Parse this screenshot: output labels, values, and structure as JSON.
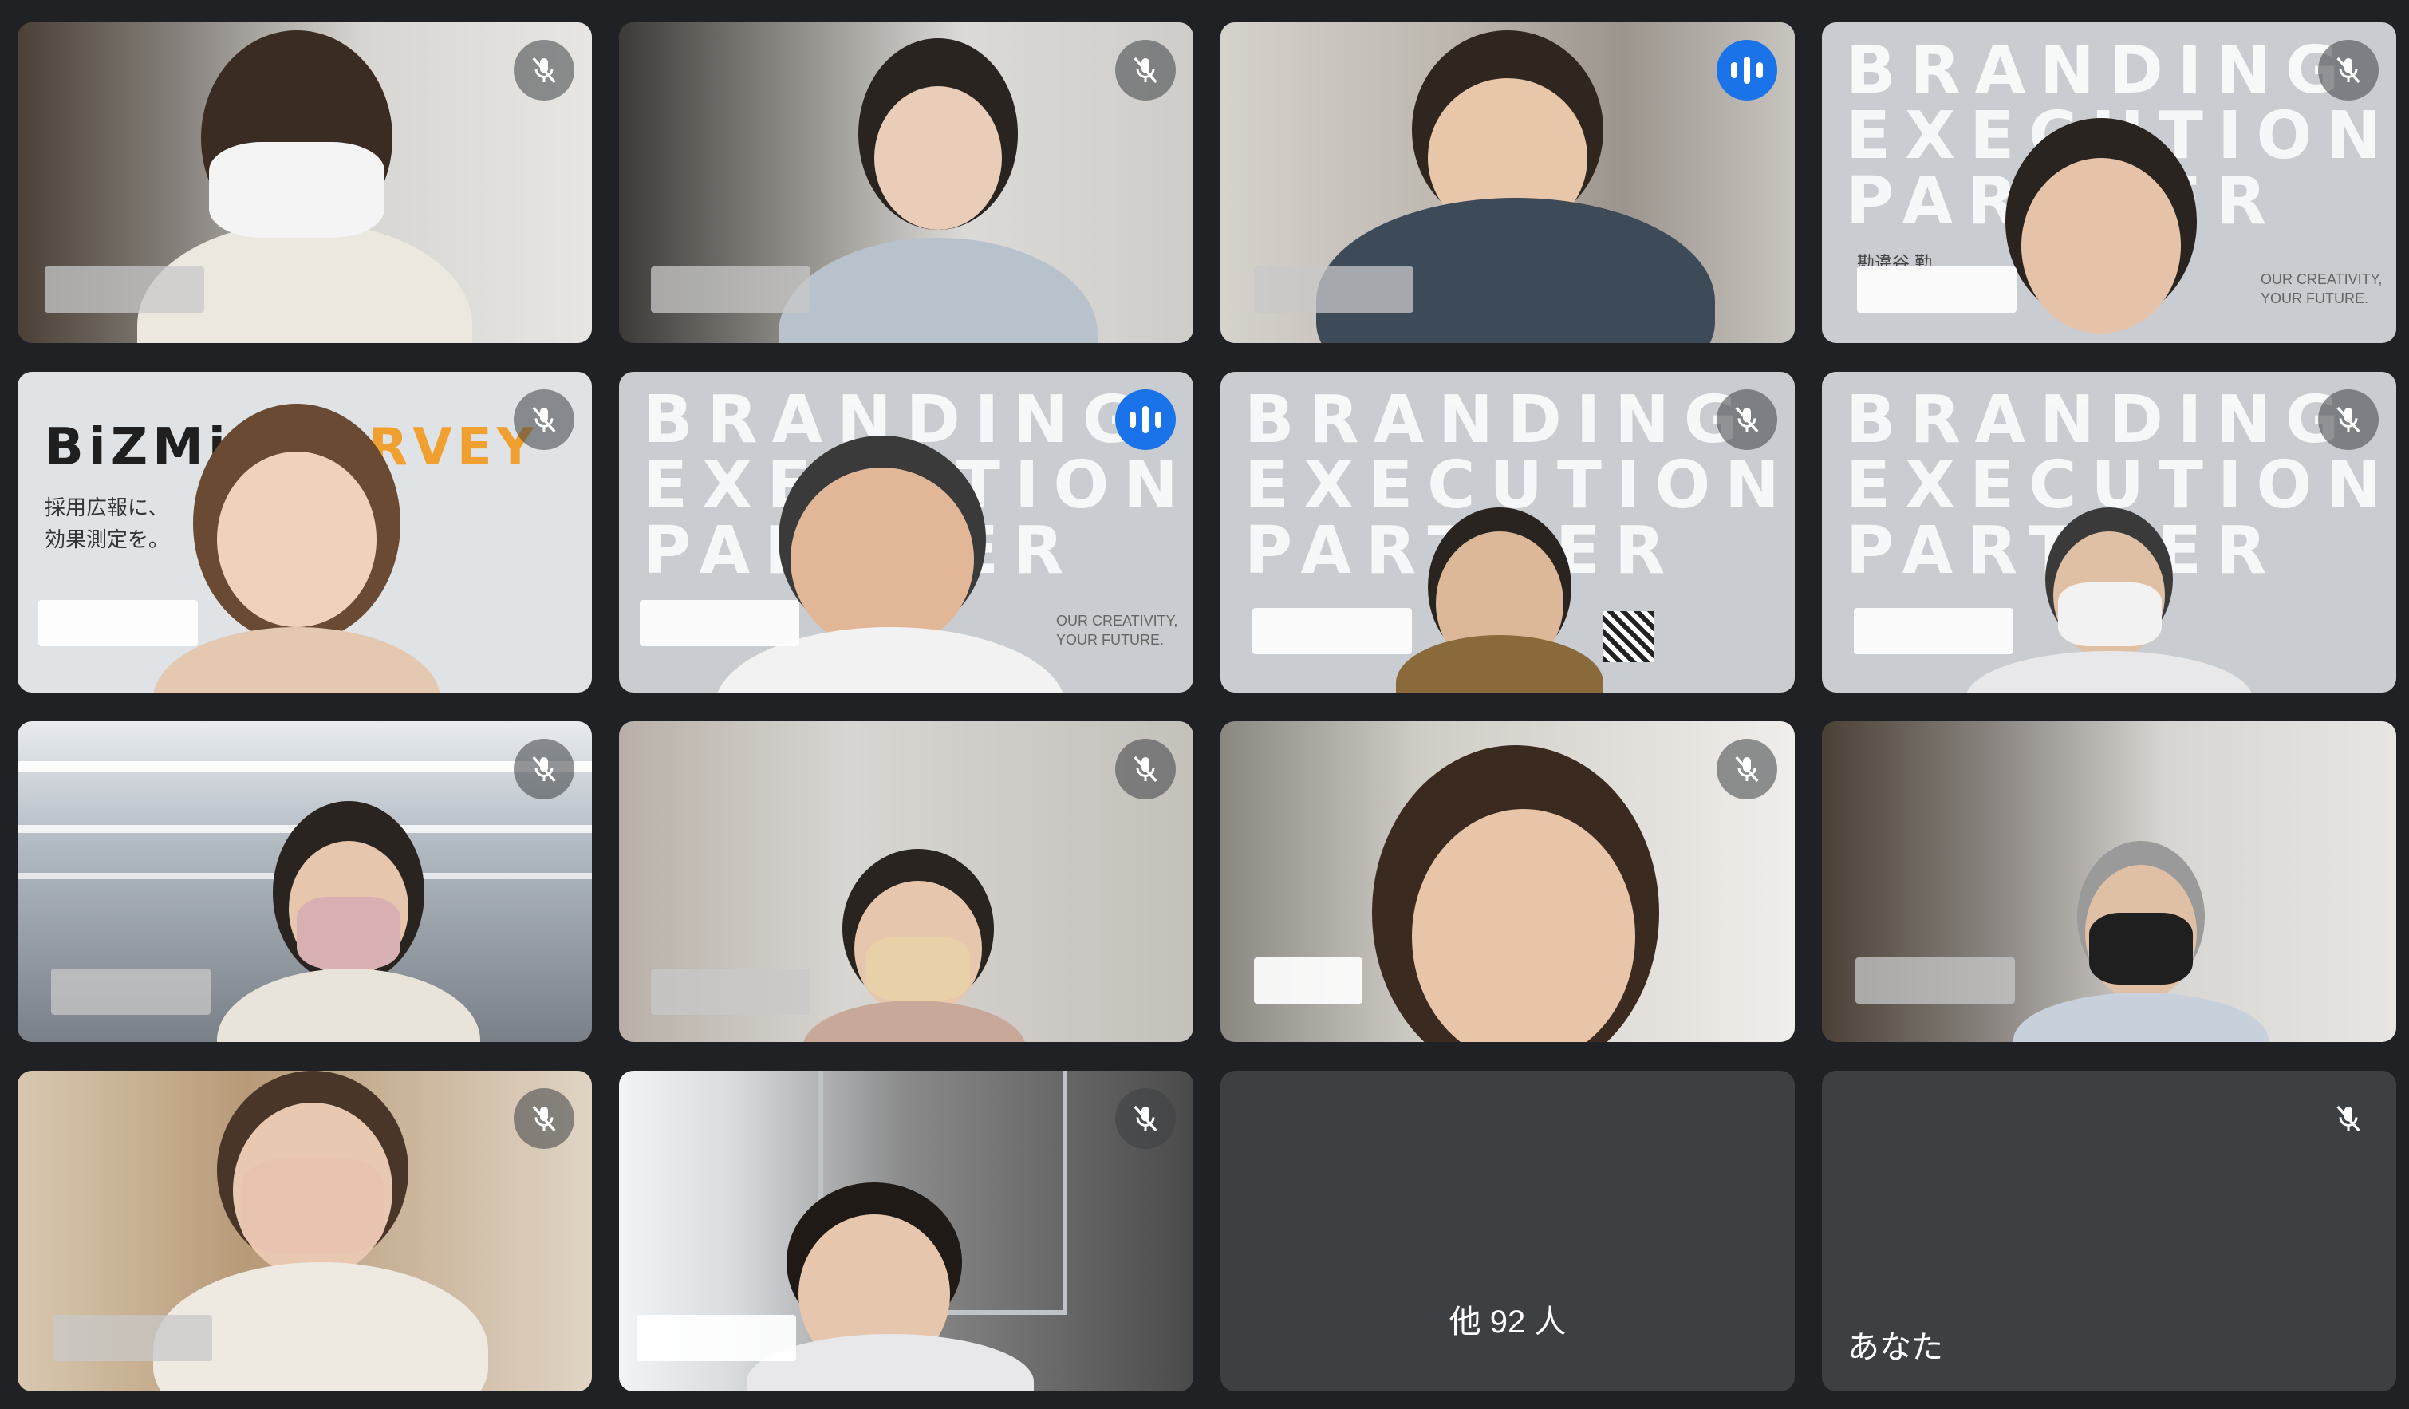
{
  "participants": [
    {
      "id": "p1",
      "muted": true,
      "speaking": false
    },
    {
      "id": "p2",
      "muted": true,
      "speaking": false
    },
    {
      "id": "p3",
      "muted": false,
      "speaking": true
    },
    {
      "id": "p4",
      "muted": true,
      "speaking": false,
      "background_text": "BRANDING EXECUTION PARTNER",
      "sub_text": "OUR CREATIVITY,\nYOUR FUTURE.",
      "name_text": "勘違谷 勤"
    },
    {
      "id": "p5",
      "muted": true,
      "speaking": false,
      "background_logo": "BiZMi",
      "background_logo2": "RVEY",
      "background_sub": "採用広報に、\n効果測定を。"
    },
    {
      "id": "p6",
      "muted": false,
      "speaking": true,
      "background_text": "BRANDING EXECUTION PARTNER",
      "sub_text": "OUR CREATIVITY,\nYOUR FUTURE."
    },
    {
      "id": "p7",
      "muted": true,
      "speaking": false,
      "background_text": "BRANDING EXECUTION PARTNER"
    },
    {
      "id": "p8",
      "muted": true,
      "speaking": false,
      "background_text": "BRANDING EXECUTION PARTNER"
    },
    {
      "id": "p9",
      "muted": true,
      "speaking": false
    },
    {
      "id": "p10",
      "muted": true,
      "speaking": false
    },
    {
      "id": "p11",
      "muted": true,
      "speaking": false
    },
    {
      "id": "p12",
      "muted": false,
      "speaking": false
    },
    {
      "id": "p13",
      "muted": true,
      "speaking": false
    },
    {
      "id": "p14",
      "muted": true,
      "speaking": false
    }
  ],
  "others_tile": {
    "label": "他 92 人"
  },
  "self_tile": {
    "label": "あなた",
    "muted": true
  },
  "colors": {
    "background": "#202124",
    "tile": "#3c4043",
    "active_border": "#669df6",
    "speaking": "#1a73e8"
  },
  "icons": {
    "muted": "mic-off-icon",
    "speaking": "audio-level-icon"
  }
}
